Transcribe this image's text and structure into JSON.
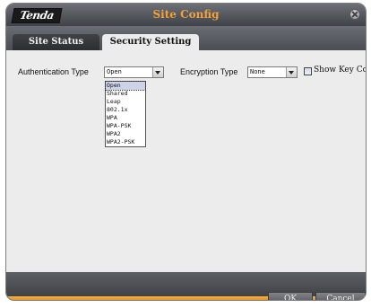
{
  "window": {
    "title": "Site Config",
    "logo_text": "Tenda"
  },
  "tabs": [
    {
      "label": "Site Status",
      "active": false
    },
    {
      "label": "Security Setting",
      "active": true
    }
  ],
  "form": {
    "authentication": {
      "label": "Authentication Type",
      "value": "Open",
      "options": [
        "Open",
        "Shared",
        "Leap",
        "802.1x",
        "WPA",
        "WPA-PSK",
        "WPA2",
        "WPA2-PSK"
      ]
    },
    "encryption": {
      "label": "Encryption Type",
      "value": "None"
    },
    "show_key_content": {
      "label": "Show Key Content",
      "checked": false
    }
  },
  "buttons": {
    "ok": "OK",
    "cancel": "Cancel"
  },
  "colors": {
    "title_orange": "#f2a13a",
    "accent_orange": "#e37b10",
    "titlebar_gray": "#4a4d52",
    "content_bg": "#ececec"
  },
  "icons": {
    "close": "close-icon",
    "dropdown": "chevron-down-icon"
  }
}
